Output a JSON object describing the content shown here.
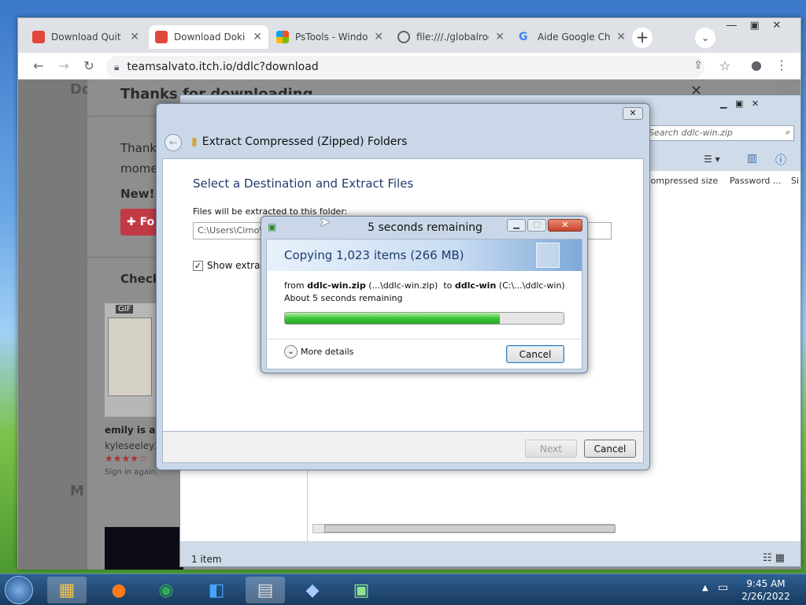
{
  "browser": {
    "tabs": [
      {
        "title": "Download Quit",
        "color": "#e0483d"
      },
      {
        "title": "Download Doki",
        "color": "#e0483d"
      },
      {
        "title": "PsTools - Windo",
        "color": "#2f9bd6"
      },
      {
        "title": "file:///./globalroo",
        "color": "#5f6368"
      },
      {
        "title": "Aide Google Ch",
        "color": "#4285f4"
      }
    ],
    "url": "teamsalvato.itch.io/ddlc?download"
  },
  "itch_page": {
    "heading": "Thanks for downloading",
    "para": "Thanks",
    "para2": "mome",
    "new_label": "New! T",
    "follow_label": "Fo",
    "check_label": "Check",
    "gif_badge": "GIF",
    "card_title": "emily is aw",
    "card_author": "kyleseeley2",
    "card_meta": "Sign in again.",
    "rating_stars": 4,
    "side_d": "Do",
    "side_m": "M"
  },
  "explorer": {
    "search_placeholder": "Search ddlc-win.zip",
    "col_compressed": "Compressed size",
    "col_password": "Password ...",
    "col_si": "Si",
    "status": "1 item"
  },
  "wizard": {
    "title": "Extract Compressed (Zipped) Folders",
    "heading": "Select a Destination and Extract Files",
    "folder_label": "Files will be extracted to this folder:",
    "folder_value": "C:\\Users\\Cirno\\",
    "show_label": "Show extracte",
    "next": "Next",
    "cancel": "Cancel"
  },
  "progress": {
    "title": "5 seconds remaining",
    "header": "Copying 1,023 items (266 MB)",
    "from_label": "from",
    "from_name": "ddlc-win.zip",
    "from_path": "(...\\ddlc-win.zip)",
    "to_label": "to",
    "to_name": "ddlc-win",
    "to_path": "(C:\\...\\ddlc-win)",
    "remaining": "About 5 seconds remaining",
    "percent": 77,
    "more_details": "More details",
    "cancel": "Cancel"
  },
  "taskbar": {
    "time": "9:45 AM",
    "date": "2/26/2022"
  }
}
